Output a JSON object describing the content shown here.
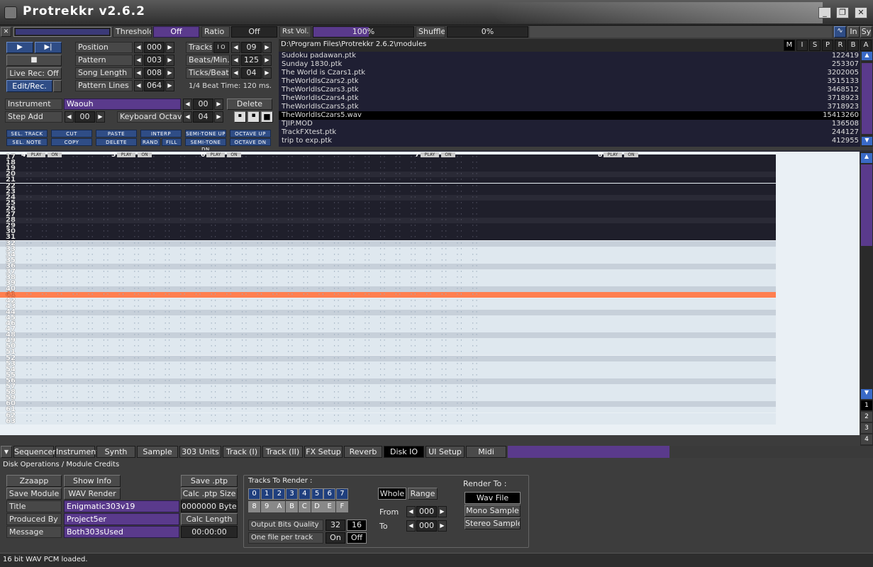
{
  "window": {
    "title": "Protrekkr v2.6.2"
  },
  "toolbar_top": {
    "threshold_label": "Threshold",
    "threshold_value": "Off",
    "ratio_label": "Ratio",
    "ratio_value": "Off",
    "rst_vol_label": "Rst Vol.",
    "rst_vol_value": "100%",
    "rst_vol_level": 0.55,
    "shuffle_label": "Shuffle",
    "shuffle_value": "0%",
    "right_buttons": [
      "In",
      "Sy"
    ]
  },
  "transport": {
    "live_rec": "Live Rec: Off",
    "edit_rec": "Edit/Rec."
  },
  "song": {
    "position_label": "Position",
    "position": "000",
    "pattern_label": "Pattern",
    "pattern": "003",
    "song_length_label": "Song Length",
    "song_length": "008",
    "pattern_lines_label": "Pattern Lines",
    "pattern_lines": "064",
    "tracks_label": "Tracks",
    "tracks_io": "I O",
    "tracks": "09",
    "bpm_label": "Beats/Min.",
    "bpm": "125",
    "ticks_label": "Ticks/Beat",
    "ticks": "04",
    "beat_time": "1/4 Beat Time: 120 ms."
  },
  "instrument": {
    "label": "Instrument",
    "name": "Waouh",
    "number": "00",
    "delete": "Delete",
    "step_add_label": "Step Add",
    "step_add": "00",
    "kb_octave_label": "Keyboard Octave",
    "kb_octave": "04"
  },
  "tools": [
    [
      "SEL. TRACK",
      "CUT",
      "PASTE",
      "INTERP",
      "SEMI-TONE UP",
      "OCTAVE UP"
    ],
    [
      "SEL. NOTE",
      "COPY",
      "DELETE",
      "RAND",
      "FILL",
      "SEMI-TONE DN",
      "OCTAVE DN"
    ]
  ],
  "disk": {
    "path": "D:\\Program Files\\Protrekkr 2.6.2\\modules",
    "filters": [
      "M",
      "I",
      "S",
      "P",
      "R",
      "B",
      "A"
    ],
    "files": [
      {
        "name": "Sudoku padawan.ptk",
        "size": "122419"
      },
      {
        "name": "Sunday 1830.ptk",
        "size": "253307"
      },
      {
        "name": "The World is Czars1.ptk",
        "size": "3202005"
      },
      {
        "name": "TheWorldIsCzars2.ptk",
        "size": "3515133"
      },
      {
        "name": "TheWorldIsCzars3.ptk",
        "size": "3468512"
      },
      {
        "name": "TheWorldIsCzars4.ptk",
        "size": "3718923"
      },
      {
        "name": "TheWorldIsCzars5.ptk",
        "size": "3718923"
      },
      {
        "name": "TheWorldIsCzars5.wav",
        "size": "15413260",
        "selected": true
      },
      {
        "name": "TJIP.MOD",
        "size": "136508"
      },
      {
        "name": "TrackFXtest.ptk",
        "size": "244127"
      },
      {
        "name": "trip to exp.ptk",
        "size": "412955"
      }
    ]
  },
  "pattern": {
    "tracks": [
      {
        "num": "4",
        "play": "PLAY",
        "on": "ON"
      },
      {
        "num": "5",
        "play": "PLAY",
        "on": "ON"
      },
      {
        "num": "6",
        "play": "PLAY",
        "on": "ON"
      },
      {
        "num": "7",
        "play": "PLAY",
        "on": "ON"
      },
      {
        "num": "8",
        "play": "PLAY",
        "on": "ON"
      }
    ],
    "rows": [
      "17",
      "18",
      "19",
      "20",
      "21",
      "22",
      "23",
      "24",
      "25",
      "26",
      "27",
      "28",
      "29",
      "30",
      "31",
      "32",
      "33",
      "34",
      "35",
      "36",
      "37",
      "38",
      "39",
      "40",
      "41",
      "42",
      "43",
      "44",
      "45",
      "46",
      "47",
      "48",
      "49",
      "50",
      "51",
      "52",
      "53",
      "54",
      "55",
      "56",
      "57",
      "58",
      "59",
      "60",
      "61",
      "62",
      "63"
    ],
    "current_row": "41",
    "page_numbers": [
      "1",
      "2",
      "3",
      "4"
    ]
  },
  "tabs": [
    "Sequencer",
    "Instrument",
    "Synth",
    "Sample Ed.",
    "303 Units",
    "Track (I)",
    "Track (II)",
    "FX Setup",
    "Reverb",
    "Disk IO",
    "UI Setup",
    "Midi Setup"
  ],
  "active_tab": "Disk IO",
  "diskops": {
    "header": "Disk Operations / Module Credits",
    "zzaapp": "Zzaapp",
    "show_info": "Show Info",
    "save_module": "Save Module",
    "wav_render": "WAV Render",
    "title_label": "Title",
    "title": "Enigmatic303v19",
    "produced_label": "Produced By",
    "produced": "Project5er",
    "message_label": "Message",
    "message": "Both303sUsed",
    "save_ptp": "Save .ptp",
    "calc_ptp": "Calc .ptp Size",
    "bytes": "0000000 Bytes",
    "calc_length": "Calc Length",
    "length": "00:00:00"
  },
  "render": {
    "tracks_label": "Tracks To Render :",
    "track_row1": [
      "0",
      "1",
      "2",
      "3",
      "4",
      "5",
      "6",
      "7"
    ],
    "track_row2": [
      "8",
      "9",
      "A",
      "B",
      "C",
      "D",
      "E",
      "F"
    ],
    "output_bits_label": "Output Bits Quality",
    "bits_32": "32",
    "bits_16": "16",
    "one_file_label": "One file per track",
    "on": "On",
    "off": "Off",
    "whole": "Whole",
    "range": "Range",
    "from_label": "From",
    "from": "000",
    "to_label": "To",
    "to": "000",
    "render_to_label": "Render To :",
    "wav_file": "Wav File",
    "mono_sample": "Mono Sample",
    "stereo_sample": "Stereo Sample"
  },
  "status": "16 bit WAV PCM loaded.",
  "colors": {
    "accent": "#5a3a8c",
    "blue": "#2f4d86",
    "cursor_row": "#ff7f50"
  }
}
